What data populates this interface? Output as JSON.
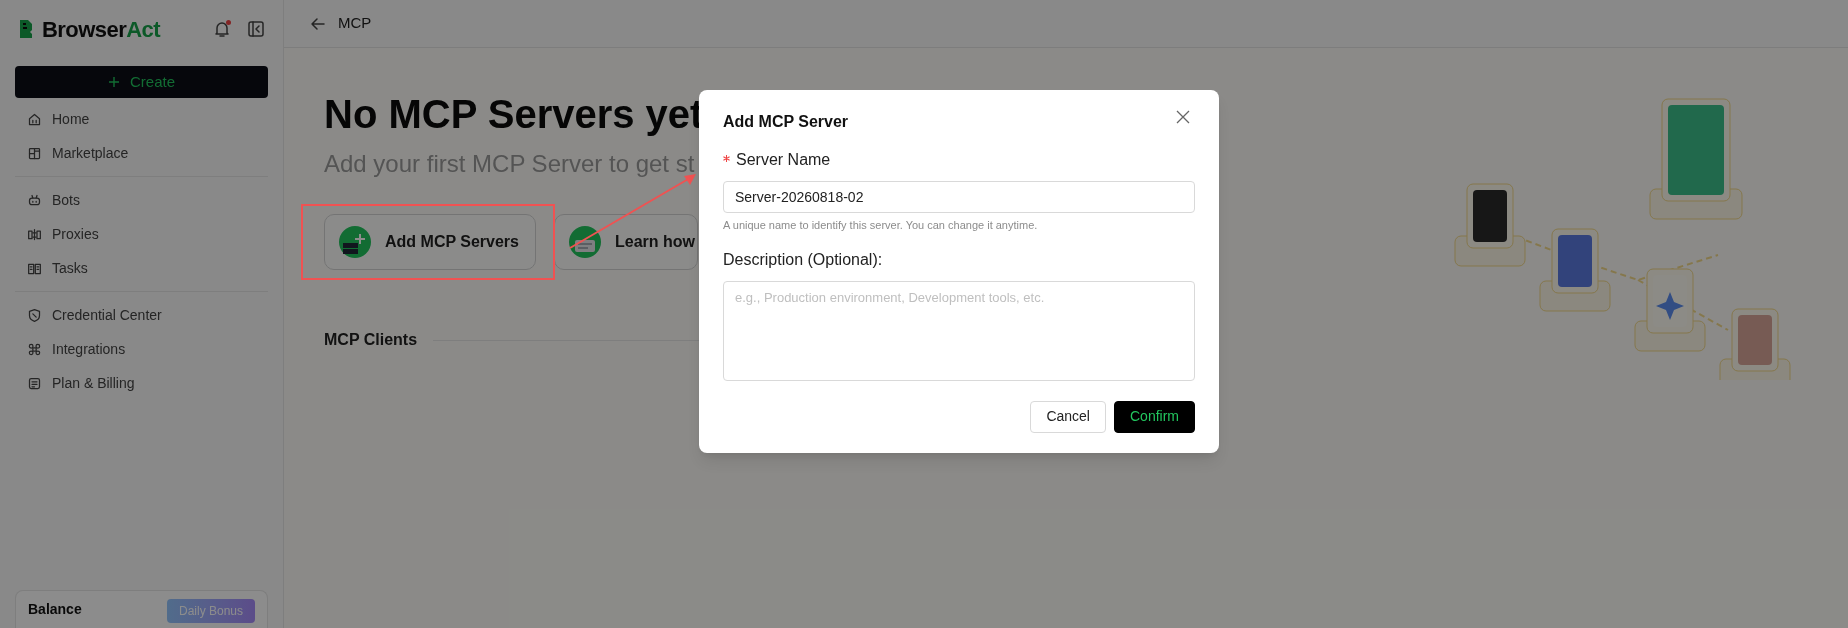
{
  "brand": {
    "main": "Browser",
    "accent": "Act"
  },
  "notifications": {
    "unread": true
  },
  "create_button": {
    "label": "Create"
  },
  "sidebar": {
    "groups": [
      [
        {
          "label": "Home",
          "kind": "home"
        },
        {
          "label": "Marketplace",
          "kind": "store"
        }
      ],
      [
        {
          "label": "Bots",
          "kind": "bot"
        },
        {
          "label": "Proxies",
          "kind": "proxy"
        },
        {
          "label": "Tasks",
          "kind": "book"
        }
      ],
      [
        {
          "label": "Credential Center",
          "kind": "shield"
        },
        {
          "label": "Integrations",
          "kind": "command"
        },
        {
          "label": "Plan & Billing",
          "kind": "billing"
        }
      ]
    ]
  },
  "balance": {
    "label": "Balance",
    "bonus_button": "Daily Bonus"
  },
  "header": {
    "title": "MCP"
  },
  "hero": {
    "title": "No MCP Servers yet",
    "subtitle": "Add your first MCP Server to get st"
  },
  "actions": [
    {
      "label": "Add MCP Servers",
      "kind": "add",
      "annotated": true
    },
    {
      "label": "Learn how",
      "kind": "blog",
      "annotated": false
    }
  ],
  "annotation_arrow": true,
  "section": {
    "title": "MCP Clients"
  },
  "dialog": {
    "title": "Add MCP Server",
    "fields": [
      {
        "kind": "input",
        "label": "Server Name",
        "required": true,
        "value": "Server-20260818-02",
        "hint": "A unique name to identify this server. You can change it anytime."
      },
      {
        "kind": "textarea",
        "label": "Description (Optional):",
        "required": false,
        "placeholder": "e.g., Production environment, Development tools, etc."
      }
    ],
    "buttons": [
      {
        "label": "Cancel",
        "kind": "secondary"
      },
      {
        "label": "Confirm",
        "kind": "primary"
      }
    ]
  }
}
